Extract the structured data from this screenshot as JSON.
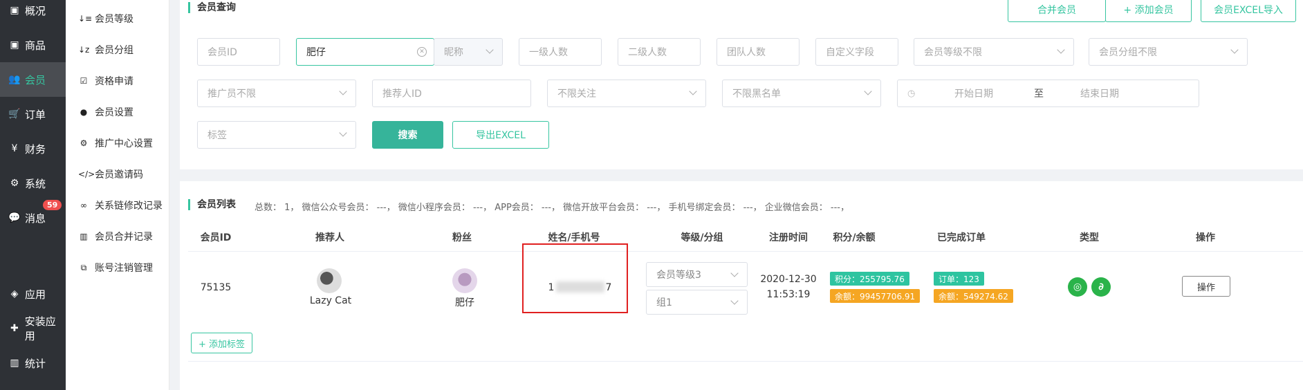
{
  "sidebar": {
    "items": [
      {
        "label": "概况",
        "icon": "archive-icon"
      },
      {
        "label": "商品",
        "icon": "archive-icon"
      },
      {
        "label": "会员",
        "icon": "users-icon"
      },
      {
        "label": "订单",
        "icon": "cart-icon"
      },
      {
        "label": "财务",
        "icon": "yen-icon"
      },
      {
        "label": "系统",
        "icon": "gears-icon"
      },
      {
        "label": "消息",
        "icon": "comment-icon"
      },
      {
        "label": "应用",
        "icon": "cubes-icon"
      },
      {
        "label": "安装应用",
        "icon": "puzzle-icon"
      },
      {
        "label": "统计",
        "icon": "bar-chart-icon"
      }
    ],
    "message_badge": "59"
  },
  "subnav": {
    "items": [
      {
        "label": "会员等级",
        "icon": "sort-icon"
      },
      {
        "label": "会员分组",
        "icon": "sort-alpha-icon"
      },
      {
        "label": "资格申请",
        "icon": "check-square-icon"
      },
      {
        "label": "会员设置",
        "icon": "user-icon"
      },
      {
        "label": "推广中心设置",
        "icon": "gear-icon"
      },
      {
        "label": "会员邀请码",
        "icon": "code-icon"
      },
      {
        "label": "关系链修改记录",
        "icon": "link-icon"
      },
      {
        "label": "会员合并记录",
        "icon": "bar-chart-icon"
      },
      {
        "label": "账号注销管理",
        "icon": "copy-icon"
      }
    ]
  },
  "query": {
    "title": "会员查询",
    "merge_button": "合并会员",
    "add_button": "+ 添加会员",
    "import_button": "会员EXCEL导入",
    "fields": {
      "member_id": "会员ID",
      "nickname_value": "肥仔",
      "nickname_type": "昵称",
      "level1_count": "一级人数",
      "level2_count": "二级人数",
      "team_count": "团队人数",
      "custom_field": "自定义字段",
      "level_select": "会员等级不限",
      "group_select": "会员分组不限",
      "promoter_select": "推广员不限",
      "referrer_id": "推荐人ID",
      "follow_select": "不限关注",
      "blacklist_select": "不限黑名单",
      "start_date": "开始日期",
      "date_sep": "至",
      "end_date": "结束日期",
      "tag_select": "标签"
    },
    "search_button": "搜索",
    "export_button": "导出EXCEL"
  },
  "list": {
    "title": "会员列表",
    "summary": "总数：  1，   微信公众号会员：  ---，   微信小程序会员：  ---，   APP会员：  ---，   微信开放平台会员：  ---，   手机号绑定会员：  ---，   企业微信会员：  ---，",
    "columns": [
      "会员ID",
      "推荐人",
      "粉丝",
      "姓名/手机号",
      "等级/分组",
      "注册时间",
      "积分/余额",
      "已完成订单",
      "类型",
      "操作"
    ],
    "row": {
      "member_id": "75135",
      "referrer_name": "Lazy Cat",
      "fan_name": "肥仔",
      "phone_start": "1",
      "phone_end": "7",
      "level": "会员等级3",
      "group": "组1",
      "reg_date": "2020-12-30",
      "reg_time": "11:53:19",
      "points": "积分：255795.76",
      "balance": "余额：99457706.91",
      "orders": "订单：123",
      "order_amount": "余额：549274.62",
      "action_button": "操作"
    },
    "add_tag_button": "+ 添加标签"
  },
  "colors": {
    "accent": "#36c5a0",
    "sidebar_bg": "#2e3136",
    "badge": "#f0504f",
    "tag_green": "#2ec4a0",
    "tag_orange": "#f5a623",
    "highlight_box": "#e02020"
  }
}
